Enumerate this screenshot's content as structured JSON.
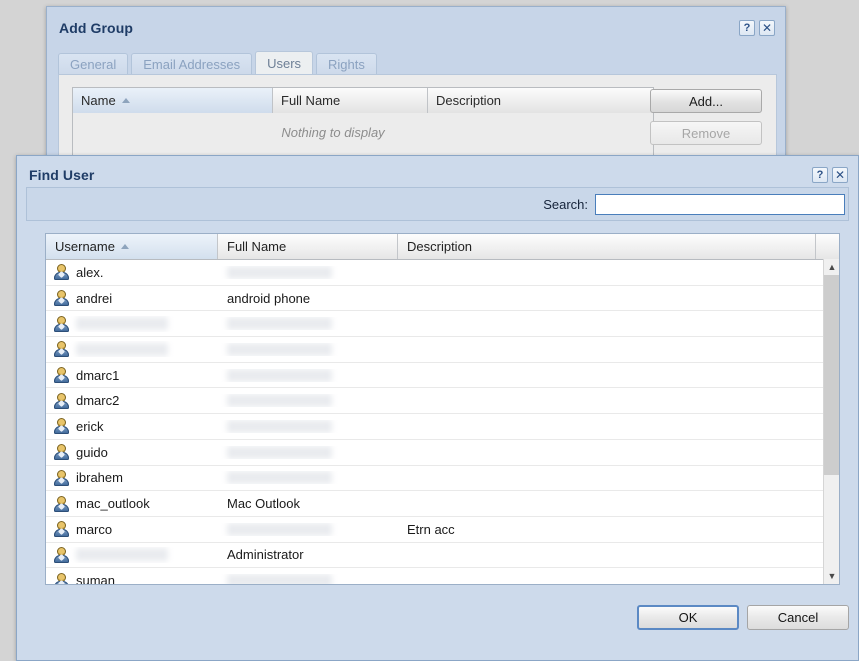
{
  "add_group": {
    "title": "Add Group",
    "help_label": "?",
    "close_label": "✕",
    "tabs": [
      {
        "label": "General",
        "active": false
      },
      {
        "label": "Email Addresses",
        "active": false
      },
      {
        "label": "Users",
        "active": true
      },
      {
        "label": "Rights",
        "active": false
      }
    ],
    "grid": {
      "columns": [
        "Name",
        "Full Name",
        "Description"
      ],
      "sorted_column": "Name",
      "sort_direction": "asc",
      "empty_text": "Nothing to display"
    },
    "buttons": {
      "add": "Add...",
      "remove": "Remove"
    }
  },
  "find_user": {
    "title": "Find User",
    "help_label": "?",
    "close_label": "✕",
    "search": {
      "label": "Search:",
      "value": "",
      "placeholder": ""
    },
    "grid": {
      "columns": [
        "Username",
        "Full Name",
        "Description",
        ""
      ],
      "sorted_column": "Username",
      "sort_direction": "asc",
      "rows": [
        {
          "username": "alex.",
          "username_blurred": false,
          "fullname": "",
          "fullname_blurred": true,
          "description": "",
          "description_blurred": false
        },
        {
          "username": "andrei",
          "username_blurred": false,
          "fullname": "android phone",
          "fullname_blurred": false,
          "description": "",
          "description_blurred": false
        },
        {
          "username": "",
          "username_blurred": true,
          "fullname": "",
          "fullname_blurred": true,
          "description": "",
          "description_blurred": false
        },
        {
          "username": "",
          "username_blurred": true,
          "fullname": "",
          "fullname_blurred": true,
          "description": "",
          "description_blurred": false
        },
        {
          "username": "dmarc1",
          "username_blurred": false,
          "fullname": "",
          "fullname_blurred": true,
          "description": "",
          "description_blurred": false
        },
        {
          "username": "dmarc2",
          "username_blurred": false,
          "fullname": "",
          "fullname_blurred": true,
          "description": "",
          "description_blurred": false
        },
        {
          "username": "erick",
          "username_blurred": false,
          "fullname": "",
          "fullname_blurred": true,
          "description": "",
          "description_blurred": false
        },
        {
          "username": "guido",
          "username_blurred": false,
          "fullname": "",
          "fullname_blurred": true,
          "description": "",
          "description_blurred": false
        },
        {
          "username": "ibrahem",
          "username_blurred": false,
          "fullname": "",
          "fullname_blurred": true,
          "description": "",
          "description_blurred": false
        },
        {
          "username": "mac_outlook",
          "username_blurred": false,
          "fullname": "Mac Outlook",
          "fullname_blurred": false,
          "description": "",
          "description_blurred": false
        },
        {
          "username": "marco",
          "username_blurred": false,
          "fullname": "",
          "fullname_blurred": true,
          "description": "Etrn acc",
          "description_blurred": false
        },
        {
          "username": "",
          "username_blurred": true,
          "fullname": "Administrator",
          "fullname_blurred": false,
          "description": "",
          "description_blurred": false
        },
        {
          "username": "suman",
          "username_blurred": false,
          "fullname": "",
          "fullname_blurred": true,
          "description": "",
          "description_blurred": false
        }
      ]
    },
    "scrollbar": {
      "up_glyph": "▲",
      "down_glyph": "▼"
    },
    "buttons": {
      "ok": "OK",
      "cancel": "Cancel"
    }
  },
  "colors": {
    "desktop": "#d4d4d4",
    "dialog_chrome": "#cddaeb",
    "title_text": "#1f3c66",
    "focus_border": "#4a7ebb"
  }
}
